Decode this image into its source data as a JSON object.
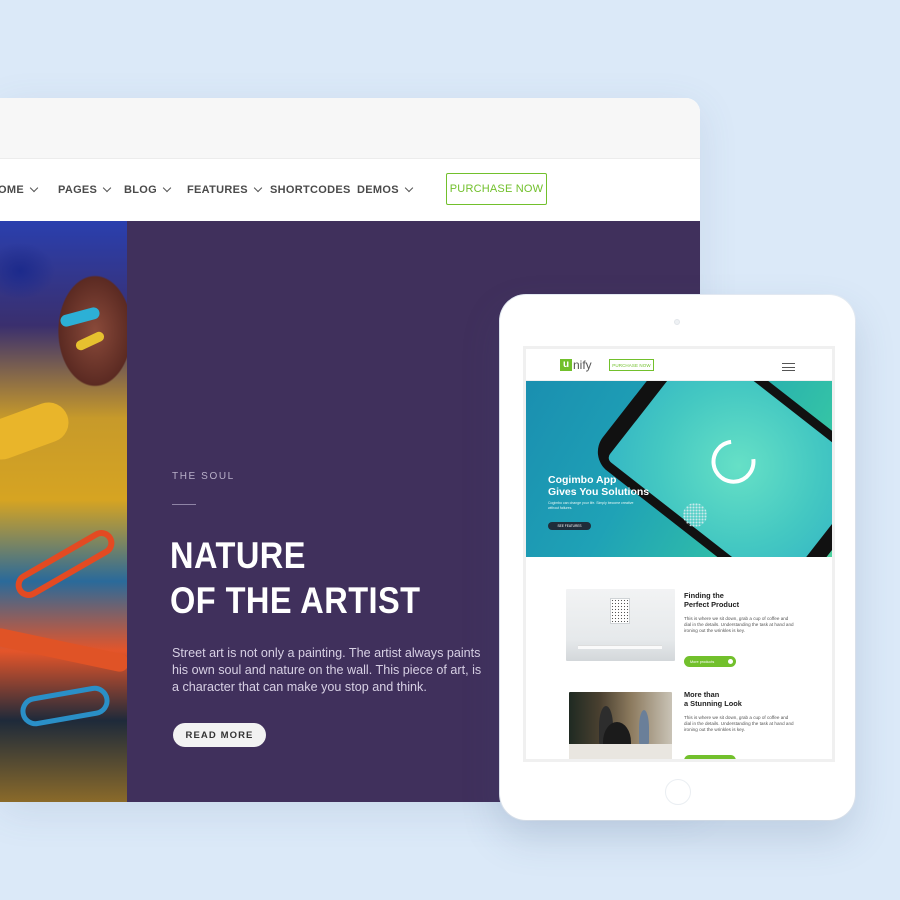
{
  "desktop": {
    "nav": {
      "items": [
        {
          "label": "OME",
          "dropdown": true
        },
        {
          "label": "PAGES",
          "dropdown": true
        },
        {
          "label": "BLOG",
          "dropdown": true
        },
        {
          "label": "FEATURES",
          "dropdown": true
        },
        {
          "label": "SHORTCODES",
          "dropdown": false
        },
        {
          "label": "DEMOS",
          "dropdown": true
        }
      ],
      "purchase_label": "PURCHASE NOW"
    },
    "hero": {
      "kicker": "THE SOUL",
      "title_line1": "NATURE",
      "title_line2": "OF THE ARTIST",
      "body": "Street art is not only a painting. The artist always paints his own soul and nature on the wall. This piece of art, is a character that can make you stop and think.",
      "button_label": "READ MORE"
    }
  },
  "tablet": {
    "header": {
      "logo_letter": "u",
      "logo_rest": "nify",
      "purchase_label": "PURCHASE NOW"
    },
    "hero": {
      "title_line1": "Cogimbo App",
      "title_line2": "Gives You Solutions",
      "subtitle": "Cogimbo can change your life. Simply become creative without failures.",
      "button_label": "SEE FEATURES"
    },
    "products": [
      {
        "title_line1": "Finding the",
        "title_line2": "Perfect Product",
        "text": "This is where we sit down, grab a cup of coffee and dial in the details. Understanding the task at hand and ironing out the wrinkles is key.",
        "button_label": "More products"
      },
      {
        "title_line1": "More than",
        "title_line2": "a Stunning Look",
        "text": "This is where we sit down, grab a cup of coffee and dial in the details. Understanding the task at hand and ironing out the wrinkles is key.",
        "button_label": ""
      }
    ]
  },
  "colors": {
    "background": "#dbe9f8",
    "hero_purple": "#40305c",
    "accent_green": "#72c02c"
  },
  "icons": [
    "chevron-down-icon",
    "hamburger-menu-icon",
    "arrow-right-icon"
  ]
}
